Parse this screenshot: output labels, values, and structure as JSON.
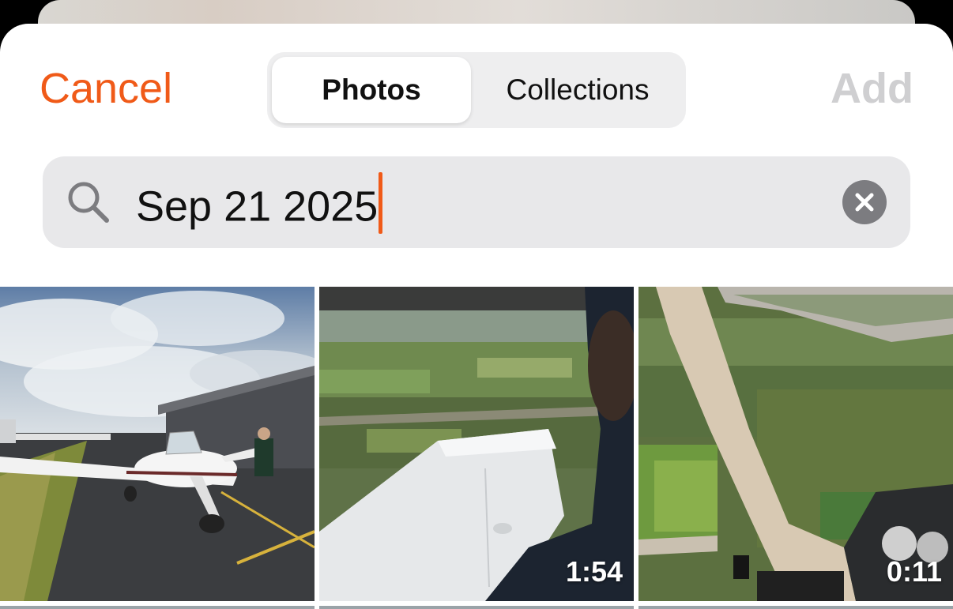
{
  "header": {
    "cancel_label": "Cancel",
    "add_label": "Add",
    "tabs": [
      {
        "label": "Photos",
        "selected": true
      },
      {
        "label": "Collections",
        "selected": false
      }
    ]
  },
  "search": {
    "value": "Sep 21 2025",
    "icon": "search-icon",
    "clear_icon": "clear-icon"
  },
  "photos": [
    {
      "kind": "photo",
      "subject": "Airplane parked by hangar on tarmac"
    },
    {
      "kind": "video",
      "duration": "1:54",
      "subject": "Aerial view over wing from cockpit"
    },
    {
      "kind": "video",
      "duration": "0:11",
      "subject": "Cockpit view of farmland"
    }
  ],
  "colors": {
    "accent": "#f05a18",
    "add_disabled": "#cfcfd1",
    "search_bg": "#e8e8ea",
    "segment_bg": "#eeeeef"
  }
}
